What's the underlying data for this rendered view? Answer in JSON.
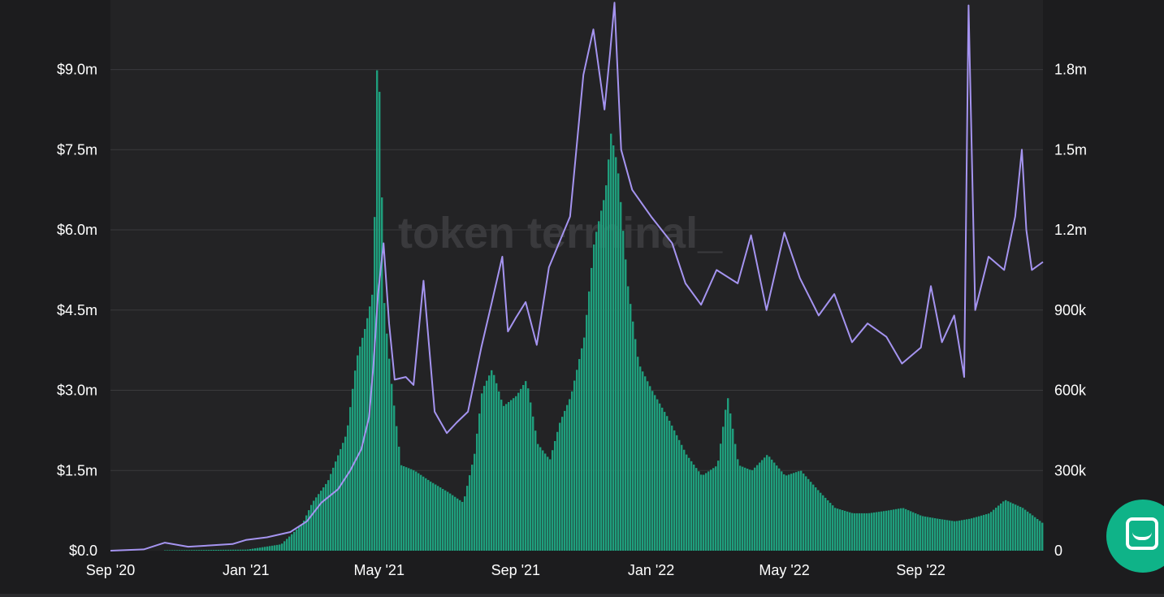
{
  "watermark": "token terminal_",
  "colors": {
    "background": "#1c1c1e",
    "plot_background": "#232325",
    "bars": "#1f9e7c",
    "bars_highlight": "#22b386",
    "line": "#a594f0",
    "grid": "#3a3a3d",
    "text": "#ffffff"
  },
  "chat_button_icon": "chat-bubble-icon",
  "chart_data": {
    "type": "bar+line",
    "title": "",
    "xlabel": "",
    "left_axis": {
      "ticks": [
        "$0.0",
        "$1.5m",
        "$3.0m",
        "$4.5m",
        "$6.0m",
        "$7.5m",
        "$9.0m"
      ],
      "tick_values": [
        0,
        1.5,
        3.0,
        4.5,
        6.0,
        7.5,
        9.0
      ],
      "ylim": [
        0,
        10.3
      ],
      "unit": "USD millions"
    },
    "right_axis": {
      "ticks": [
        "0",
        "300k",
        "600k",
        "900k",
        "1.2m",
        "1.5m",
        "1.8m"
      ],
      "tick_values": [
        0,
        300000,
        600000,
        900000,
        1200000,
        1500000,
        1800000
      ],
      "ylim": [
        0,
        2060000
      ]
    },
    "x_axis": {
      "ticks": [
        "Sep '20",
        "Jan '21",
        "May '21",
        "Sep '21",
        "Jan '22",
        "May '22",
        "Sep '22"
      ],
      "tick_dates": [
        "2020-09-01",
        "2021-01-01",
        "2021-05-01",
        "2021-09-01",
        "2022-01-01",
        "2022-05-01",
        "2022-09-01"
      ],
      "range": [
        "2020-09-01",
        "2022-12-20"
      ]
    },
    "bar_series": {
      "axis": "left",
      "points": [
        [
          "2020-09-01",
          0.0
        ],
        [
          "2020-11-01",
          0.01
        ],
        [
          "2021-01-01",
          0.02
        ],
        [
          "2021-02-01",
          0.12
        ],
        [
          "2021-02-20",
          0.5
        ],
        [
          "2021-03-01",
          0.9
        ],
        [
          "2021-03-15",
          1.3
        ],
        [
          "2021-04-01",
          2.2
        ],
        [
          "2021-04-10",
          3.6
        ],
        [
          "2021-04-18",
          4.2
        ],
        [
          "2021-04-25",
          4.9
        ],
        [
          "2021-04-29",
          9.9
        ],
        [
          "2021-05-05",
          4.5
        ],
        [
          "2021-05-12",
          3.0
        ],
        [
          "2021-05-20",
          1.6
        ],
        [
          "2021-06-01",
          1.5
        ],
        [
          "2021-06-15",
          1.3
        ],
        [
          "2021-07-01",
          1.1
        ],
        [
          "2021-07-15",
          0.9
        ],
        [
          "2021-07-25",
          1.8
        ],
        [
          "2021-08-01",
          3.0
        ],
        [
          "2021-08-10",
          3.4
        ],
        [
          "2021-08-20",
          2.7
        ],
        [
          "2021-09-01",
          2.9
        ],
        [
          "2021-09-10",
          3.2
        ],
        [
          "2021-09-20",
          2.0
        ],
        [
          "2021-10-01",
          1.7
        ],
        [
          "2021-10-10",
          2.4
        ],
        [
          "2021-10-20",
          2.9
        ],
        [
          "2021-11-01",
          4.0
        ],
        [
          "2021-11-10",
          5.8
        ],
        [
          "2021-11-20",
          6.7
        ],
        [
          "2021-11-25",
          7.8
        ],
        [
          "2021-12-01",
          7.2
        ],
        [
          "2021-12-10",
          5.0
        ],
        [
          "2021-12-20",
          3.5
        ],
        [
          "2022-01-01",
          3.0
        ],
        [
          "2022-01-15",
          2.5
        ],
        [
          "2022-02-01",
          1.8
        ],
        [
          "2022-02-15",
          1.4
        ],
        [
          "2022-03-01",
          1.6
        ],
        [
          "2022-03-10",
          2.9
        ],
        [
          "2022-03-20",
          1.6
        ],
        [
          "2022-04-01",
          1.5
        ],
        [
          "2022-04-15",
          1.8
        ],
        [
          "2022-05-01",
          1.4
        ],
        [
          "2022-05-15",
          1.5
        ],
        [
          "2022-06-01",
          1.1
        ],
        [
          "2022-06-15",
          0.8
        ],
        [
          "2022-07-01",
          0.7
        ],
        [
          "2022-07-15",
          0.7
        ],
        [
          "2022-08-01",
          0.75
        ],
        [
          "2022-08-15",
          0.8
        ],
        [
          "2022-09-01",
          0.65
        ],
        [
          "2022-09-15",
          0.6
        ],
        [
          "2022-10-01",
          0.55
        ],
        [
          "2022-10-15",
          0.6
        ],
        [
          "2022-11-01",
          0.7
        ],
        [
          "2022-11-15",
          0.95
        ],
        [
          "2022-12-01",
          0.8
        ],
        [
          "2022-12-20",
          0.5
        ]
      ]
    },
    "line_series": {
      "axis": "right",
      "points": [
        [
          "2020-09-01",
          0
        ],
        [
          "2020-10-01",
          5000
        ],
        [
          "2020-10-20",
          30000
        ],
        [
          "2020-11-10",
          15000
        ],
        [
          "2020-12-01",
          20000
        ],
        [
          "2020-12-20",
          25000
        ],
        [
          "2021-01-01",
          40000
        ],
        [
          "2021-01-20",
          50000
        ],
        [
          "2021-02-10",
          70000
        ],
        [
          "2021-02-25",
          110000
        ],
        [
          "2021-03-10",
          180000
        ],
        [
          "2021-03-25",
          230000
        ],
        [
          "2021-04-05",
          300000
        ],
        [
          "2021-04-15",
          380000
        ],
        [
          "2021-04-22",
          500000
        ],
        [
          "2021-04-26",
          700000
        ],
        [
          "2021-04-30",
          960000
        ],
        [
          "2021-05-05",
          1150000
        ],
        [
          "2021-05-10",
          850000
        ],
        [
          "2021-05-15",
          640000
        ],
        [
          "2021-05-25",
          650000
        ],
        [
          "2021-06-01",
          620000
        ],
        [
          "2021-06-10",
          1010000
        ],
        [
          "2021-06-20",
          520000
        ],
        [
          "2021-07-01",
          440000
        ],
        [
          "2021-07-10",
          480000
        ],
        [
          "2021-07-20",
          520000
        ],
        [
          "2021-08-01",
          760000
        ],
        [
          "2021-08-10",
          920000
        ],
        [
          "2021-08-20",
          1100000
        ],
        [
          "2021-08-25",
          820000
        ],
        [
          "2021-09-01",
          870000
        ],
        [
          "2021-09-10",
          930000
        ],
        [
          "2021-09-20",
          770000
        ],
        [
          "2021-10-01",
          1060000
        ],
        [
          "2021-10-10",
          1150000
        ],
        [
          "2021-10-20",
          1250000
        ],
        [
          "2021-11-01",
          1780000
        ],
        [
          "2021-11-10",
          1950000
        ],
        [
          "2021-11-20",
          1650000
        ],
        [
          "2021-11-25",
          1860000
        ],
        [
          "2021-11-29",
          2050000
        ],
        [
          "2021-12-05",
          1500000
        ],
        [
          "2021-12-15",
          1350000
        ],
        [
          "2022-01-01",
          1250000
        ],
        [
          "2022-01-20",
          1150000
        ],
        [
          "2022-02-01",
          1000000
        ],
        [
          "2022-02-15",
          920000
        ],
        [
          "2022-03-01",
          1050000
        ],
        [
          "2022-03-20",
          1000000
        ],
        [
          "2022-04-01",
          1180000
        ],
        [
          "2022-04-15",
          900000
        ],
        [
          "2022-05-01",
          1190000
        ],
        [
          "2022-05-15",
          1020000
        ],
        [
          "2022-06-01",
          880000
        ],
        [
          "2022-06-15",
          960000
        ],
        [
          "2022-07-01",
          780000
        ],
        [
          "2022-07-15",
          850000
        ],
        [
          "2022-08-01",
          800000
        ],
        [
          "2022-08-15",
          700000
        ],
        [
          "2022-09-01",
          760000
        ],
        [
          "2022-09-10",
          990000
        ],
        [
          "2022-09-20",
          780000
        ],
        [
          "2022-10-01",
          880000
        ],
        [
          "2022-10-10",
          650000
        ],
        [
          "2022-10-14",
          2040000
        ],
        [
          "2022-10-20",
          900000
        ],
        [
          "2022-11-01",
          1100000
        ],
        [
          "2022-11-15",
          1050000
        ],
        [
          "2022-11-25",
          1250000
        ],
        [
          "2022-12-01",
          1500000
        ],
        [
          "2022-12-05",
          1200000
        ],
        [
          "2022-12-10",
          1050000
        ],
        [
          "2022-12-20",
          1080000
        ]
      ]
    },
    "grid": true
  }
}
